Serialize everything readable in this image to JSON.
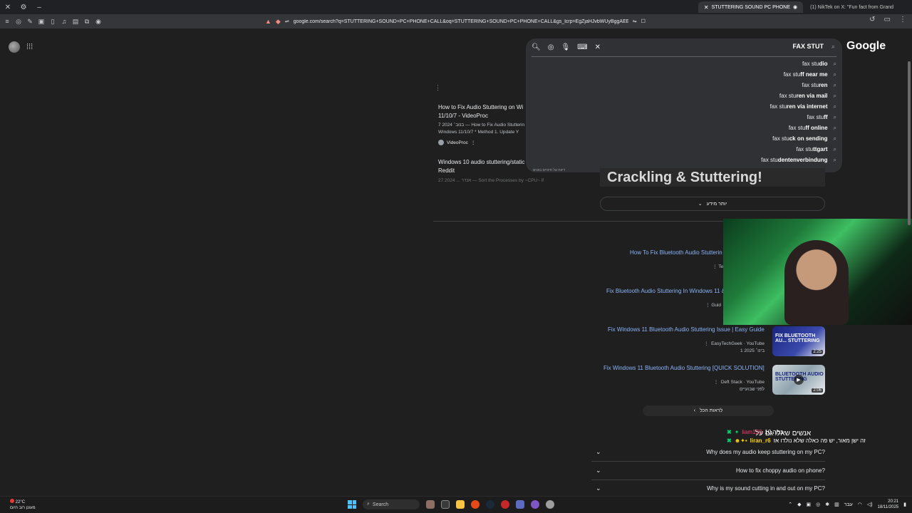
{
  "browser": {
    "tabs": [
      {
        "label": "STUTTERING SOUND PC PHONE",
        "active": true
      },
      {
        "label": "(1) NikTek on X: \"Fun fact from Grand",
        "active": false
      }
    ],
    "url": "google.com/search?q=STUTTERING+SOUND+PC+PHONE+CALL&oq=STUTTERING+SOUND+PC+PHONE+CALL&gs_lcrp=EgZjaHJvbWUyBggAEEUY..."
  },
  "google": {
    "logo": "Google",
    "query": "FAX STUT",
    "suggestions": [
      {
        "prefix": "fax stu",
        "bold": "dio"
      },
      {
        "prefix": "fax stu",
        "bold": "ff near me"
      },
      {
        "prefix": "fax stu",
        "bold": "ren"
      },
      {
        "prefix": "fax stu",
        "bold": "ren via mail"
      },
      {
        "prefix": "fax stu",
        "bold": "ren via internet"
      },
      {
        "prefix": "fax stu",
        "bold": "ff"
      },
      {
        "prefix": "fax stu",
        "bold": "ff online"
      },
      {
        "prefix": "fax stu",
        "bold": "ck on sending"
      },
      {
        "prefix": "fax stu",
        "bold": "ttgart"
      },
      {
        "prefix": "fax stu",
        "bold": "dentenverbindung"
      }
    ],
    "footer": "דיווח על חיזויים בוטים"
  },
  "results": {
    "r1_title": "How to Fix Audio Stuttering on Wi",
    "r1_title2": "11/10/7 - VideoProc",
    "r1_snip1": "7 בנוב׳ 2024 — How to Fix Audio Stutterin",
    "r1_snip2": "Windows 11/10/7 * Method 1. Update Y",
    "r1_source": "VideoProc",
    "r2_title": "Windows 10 audio stuttering/static",
    "r2_title2": "Reddit",
    "r2_snip": "27 2024 ... אנדר — Sort the Processes by ~CPU~ if",
    "crackling": "Crackling & Stuttering!",
    "more": "יותר מידע"
  },
  "videos": [
    {
      "title": "How To Fix Bluetooth Audio Stutterin",
      "meta": "Te"
    },
    {
      "title": "Fix Bluetooth Audio Stuttering In Windows 11 &",
      "meta": "Guid"
    },
    {
      "title": "Fix Windows 11 Bluetooth Audio Stuttering Issue | Easy Guide",
      "channel": "EasyTechGeek · YouTube",
      "date": "1 בינו׳ 2025",
      "thumb_text": "FIX BLUETOOTH AU... STUTTERING",
      "duration": "2:25"
    },
    {
      "title": "Fix Windows 11 Bluetooth Audio Stuttering [QUICK SOLUTION]",
      "channel": "Deft Stack · YouTube",
      "date": "לפני שבועיים",
      "thumb_text": "BLUETOOTH AUDIO STUTTERING",
      "duration": "2:06"
    }
  ],
  "see_all": "לראות הכל",
  "paa": {
    "heading": "אנשים שאלו גם על",
    "questions": [
      "Why does my audio keep stuttering on my PC?",
      "How to fix choppy audio on phone?",
      "Why is my sound cutting in and out on my PC?"
    ]
  },
  "chat": [
    {
      "user": "liam123",
      "text": "כמה 10"
    },
    {
      "user": "liran_r6",
      "text": "זה ישן מאור, יש פה כאלה שלא נולדו אז"
    }
  ],
  "taskbar": {
    "temp": "22°C",
    "weather_desc": "מעונן רוב היום",
    "search": "Search",
    "time": "20:21",
    "date": "18/11/2025",
    "lang": "עבר"
  }
}
